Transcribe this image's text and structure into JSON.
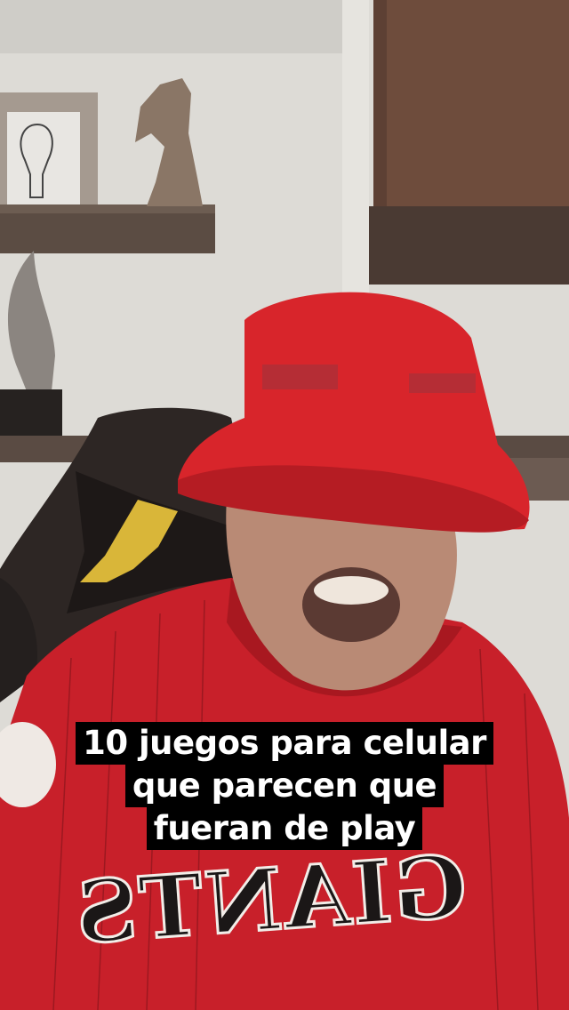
{
  "caption": {
    "lines": [
      "10 juegos para celular",
      "que parecen que",
      "fueran de play"
    ]
  },
  "scene": {
    "jersey_text": "GIANTS",
    "colors": {
      "wall": "#dcdad5",
      "cabinet": "#6b4a3a",
      "shelf": "#5a4a40",
      "hat": "#d8252b",
      "jersey": "#c8202a",
      "caption_bg": "#000000",
      "caption_text": "#ffffff"
    }
  }
}
